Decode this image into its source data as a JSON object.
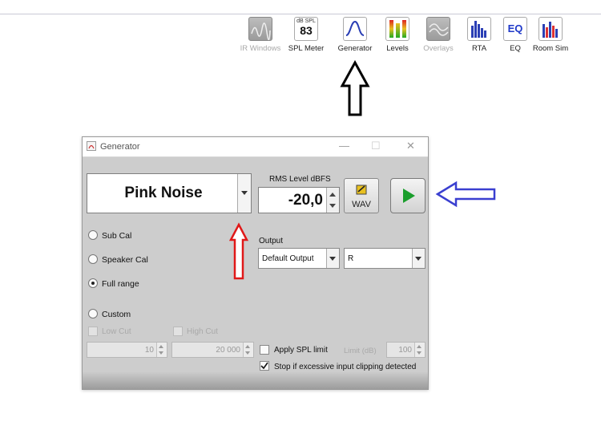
{
  "toolbar": {
    "items": [
      {
        "label": "IR Windows",
        "enabled": false,
        "icon": "ir-windows-icon"
      },
      {
        "label": "SPL Meter",
        "enabled": true,
        "icon": "spl-meter-icon",
        "badge_top": "dB SPL",
        "badge_value": "83"
      },
      {
        "label": "Generator",
        "enabled": true,
        "icon": "generator-icon"
      },
      {
        "label": "Levels",
        "enabled": true,
        "icon": "levels-icon"
      },
      {
        "label": "Overlays",
        "enabled": false,
        "icon": "overlays-icon"
      },
      {
        "label": "RTA",
        "enabled": true,
        "icon": "rta-icon"
      },
      {
        "label": "EQ",
        "enabled": true,
        "icon": "eq-icon",
        "badge_value": "EQ"
      },
      {
        "label": "Room Sim",
        "enabled": true,
        "icon": "room-sim-icon"
      }
    ]
  },
  "window": {
    "title": "Generator",
    "controls": {
      "minimize": "—",
      "maximize": "☐",
      "close": "✕"
    }
  },
  "generator": {
    "signal": "Pink Noise",
    "rms_label": "RMS Level dBFS",
    "rms_value": "-20,0",
    "wav_label": "WAV",
    "modes": [
      {
        "label": "Sub Cal",
        "selected": false
      },
      {
        "label": "Speaker Cal",
        "selected": false
      },
      {
        "label": "Full range",
        "selected": true
      },
      {
        "label": "Custom",
        "selected": false
      }
    ],
    "low_cut": {
      "label": "Low Cut",
      "value": "10",
      "enabled": false
    },
    "high_cut": {
      "label": "High Cut",
      "value": "20 000",
      "enabled": false
    },
    "output_label": "Output",
    "output_device": "Default Output",
    "output_channel": "R",
    "apply_spl_limit": {
      "label": "Apply SPL limit",
      "checked": false
    },
    "limit_label": "Limit (dB)",
    "limit_value": "100",
    "stop_clipping": {
      "label": "Stop if excessive input clipping detected",
      "checked": true
    }
  },
  "colors": {
    "play": "#1a9e2c",
    "arrow_black": "#000000",
    "arrow_blue": "#3a3fd0",
    "arrow_red": "#e01818"
  }
}
